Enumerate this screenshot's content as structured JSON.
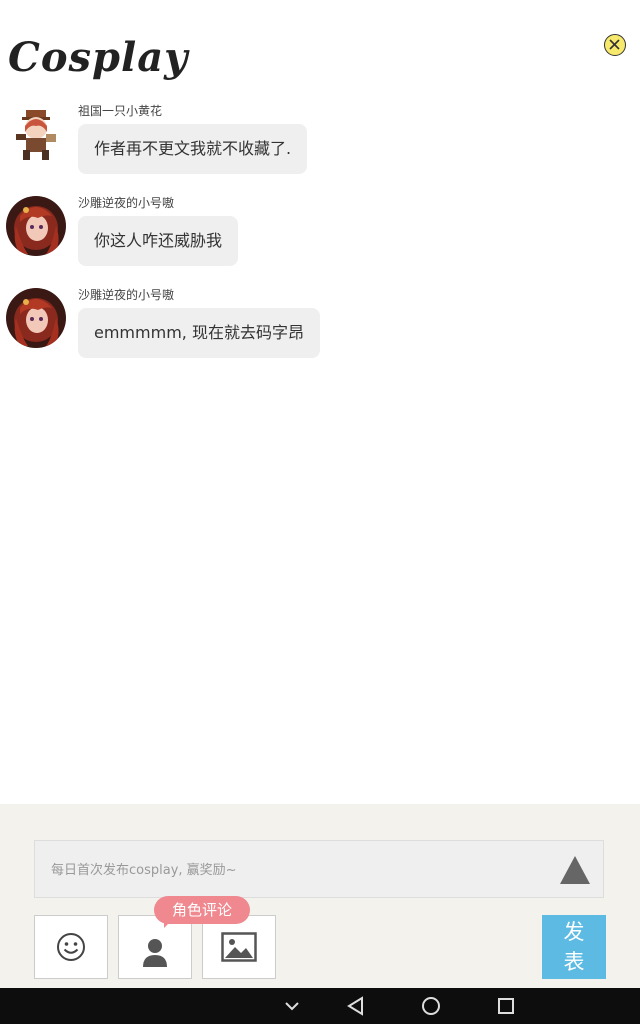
{
  "header": {
    "title": "Cosplay",
    "close_icon": "close-icon"
  },
  "messages": [
    {
      "username": "祖国一只小黄花",
      "text": "作者再不更文我就不收藏了.",
      "avatar": "chibi-character-avatar"
    },
    {
      "username": "沙雕逆夜的小号嗷",
      "text": "你这人咋还威胁我",
      "avatar": "anime-girl-avatar"
    },
    {
      "username": "沙雕逆夜的小号嗷",
      "text": "emmmmm, 现在就去码字昂",
      "avatar": "anime-girl-avatar"
    }
  ],
  "composer": {
    "placeholder": "每日首次发布cosplay, 赢奖励~",
    "role_badge": "角色评论",
    "publish_line1": "发",
    "publish_line2": "表",
    "tools": [
      "emoji-icon",
      "person-icon",
      "image-icon"
    ]
  },
  "colors": {
    "publish": "#5dbbe3",
    "badge": "#f0888f",
    "close": "#f6e96c",
    "panel": "#f4f2ec"
  },
  "navbar": {
    "icons": [
      "chevron-down-icon",
      "back-icon",
      "home-icon",
      "recents-icon"
    ]
  }
}
